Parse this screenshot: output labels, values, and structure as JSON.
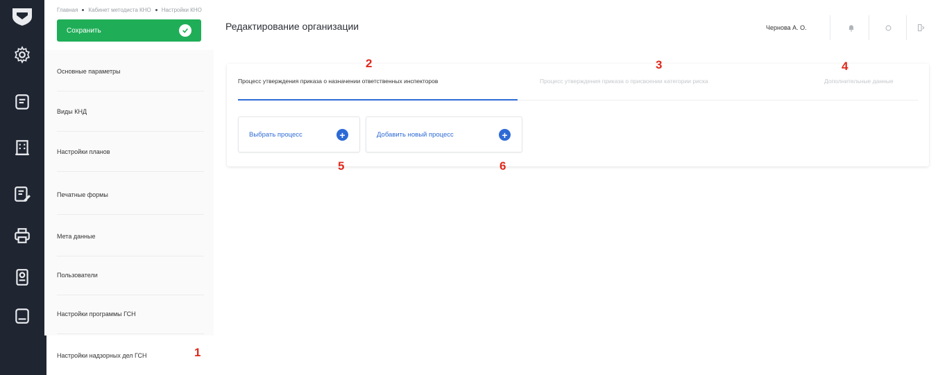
{
  "breadcrumb": [
    "Главная",
    "Кабинет методиста КНО",
    "Настройки КНО"
  ],
  "toolbar": {
    "save_label": "Сохранить"
  },
  "page": {
    "title": "Редактирование организации"
  },
  "user": {
    "name": "Чернова А. О."
  },
  "menu": {
    "items": [
      {
        "label": "Основные параметры"
      },
      {
        "label": "Виды КНД"
      },
      {
        "label": "Настройки планов"
      },
      {
        "label": "Печатные формы"
      },
      {
        "label": "Мета данные"
      },
      {
        "label": "Пользователи"
      },
      {
        "label": "Настройки программы ГСН"
      },
      {
        "label": "Настройки надзорных дел ГСН"
      }
    ],
    "active_index": 7
  },
  "tabs": [
    {
      "label": "Процесс утверждения приказа о назначении ответственных инспекторов",
      "active": true
    },
    {
      "label": "Процесс утверждения приказа о присвоении категории риска",
      "active": false
    },
    {
      "label": "Дополнительные данные",
      "active": false
    }
  ],
  "actions": {
    "select_process": "Выбрать процесс",
    "add_process": "Добавить новый процесс"
  },
  "annotations": [
    "1",
    "2",
    "3",
    "4",
    "5",
    "6"
  ],
  "colors": {
    "rail": "#1f2531",
    "save": "#1fae57",
    "accent": "#2d6ad6",
    "annotation": "#e0281b"
  }
}
